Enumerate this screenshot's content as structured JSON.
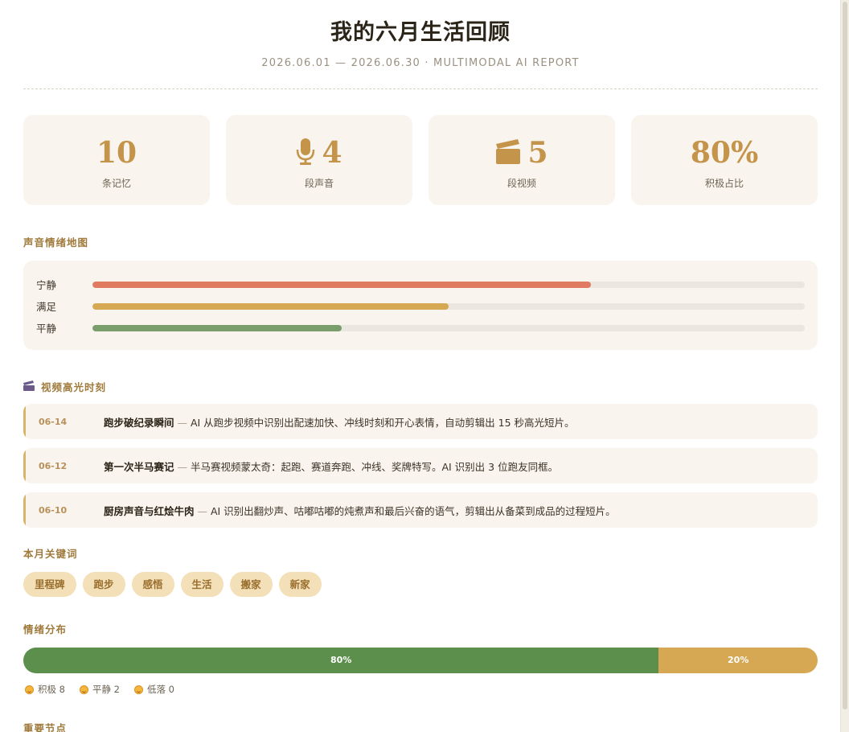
{
  "header": {
    "title": "我的六月生活回顾",
    "subtitle": "2026.06.01 — 2026.06.30 · MULTIMODAL AI REPORT"
  },
  "stats": [
    {
      "value": "10",
      "label": "条记忆",
      "icon": ""
    },
    {
      "value": "4",
      "label": "段声音",
      "icon": "microphone-icon"
    },
    {
      "value": "5",
      "label": "段视频",
      "icon": "clapperboard-icon"
    },
    {
      "value": "80%",
      "label": "积极占比",
      "icon": ""
    }
  ],
  "sections": {
    "voice_map": "声音情绪地图",
    "video_highlights": "视频高光时刻",
    "keywords": "本月关键词",
    "emotion_distribution": "情绪分布",
    "milestones": "重要节点"
  },
  "moods": [
    {
      "label": "宁静",
      "level_pct": 70,
      "color": "#e07b62"
    },
    {
      "label": "满足",
      "level_pct": 50,
      "color": "#d6a853"
    },
    {
      "label": "平静",
      "level_pct": 35,
      "color": "#7a9e6b"
    }
  ],
  "highlights": [
    {
      "date": "06-14",
      "name": "跑步破纪录瞬间",
      "sep": " — ",
      "desc": "AI 从跑步视频中识别出配速加快、冲线时刻和开心表情，自动剪辑出 15 秒高光短片。"
    },
    {
      "date": "06-12",
      "name": "第一次半马赛记",
      "sep": " — ",
      "desc": "半马赛视频蒙太奇：起跑、赛道奔跑、冲线、奖牌特写。AI 识别出 3 位跑友同框。"
    },
    {
      "date": "06-10",
      "name": "厨房声音与红烩牛肉",
      "sep": " — ",
      "desc": "AI 识别出翻炒声、咕嘟咕嘟的炖煮声和最后兴奋的语气，剪辑出从备菜到成品的过程短片。"
    }
  ],
  "keywords": [
    "里程碑",
    "跑步",
    "感悟",
    "生活",
    "搬家",
    "新家"
  ],
  "distribution": {
    "segments": [
      {
        "label": "80%",
        "pct": 80,
        "color": "#5b8f4b"
      },
      {
        "label": "20%",
        "pct": 20,
        "color": "#d6a853"
      }
    ],
    "legend": [
      "积极 8",
      "平静 2",
      "低落 0"
    ]
  }
}
